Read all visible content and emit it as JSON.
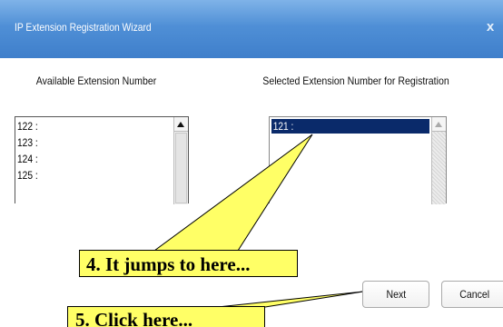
{
  "window": {
    "title": "IP Extension Registration Wizard",
    "close_glyph": "x"
  },
  "available": {
    "heading": "Available Extension Number",
    "items": [
      "122 :",
      "123 :",
      "124 :",
      "125 :"
    ]
  },
  "selected": {
    "heading": "Selected Extension Number for Registration",
    "items": [
      "121 :"
    ]
  },
  "buttons": {
    "next_label": "Next",
    "cancel_label": "Cancel"
  },
  "annotations": {
    "step4": "4. It jumps to here...",
    "step5": "5. Click here..."
  },
  "colors": {
    "titlebar": "#4f8fd6",
    "selection": "#0a2a6a",
    "callout": "#ffff66"
  }
}
